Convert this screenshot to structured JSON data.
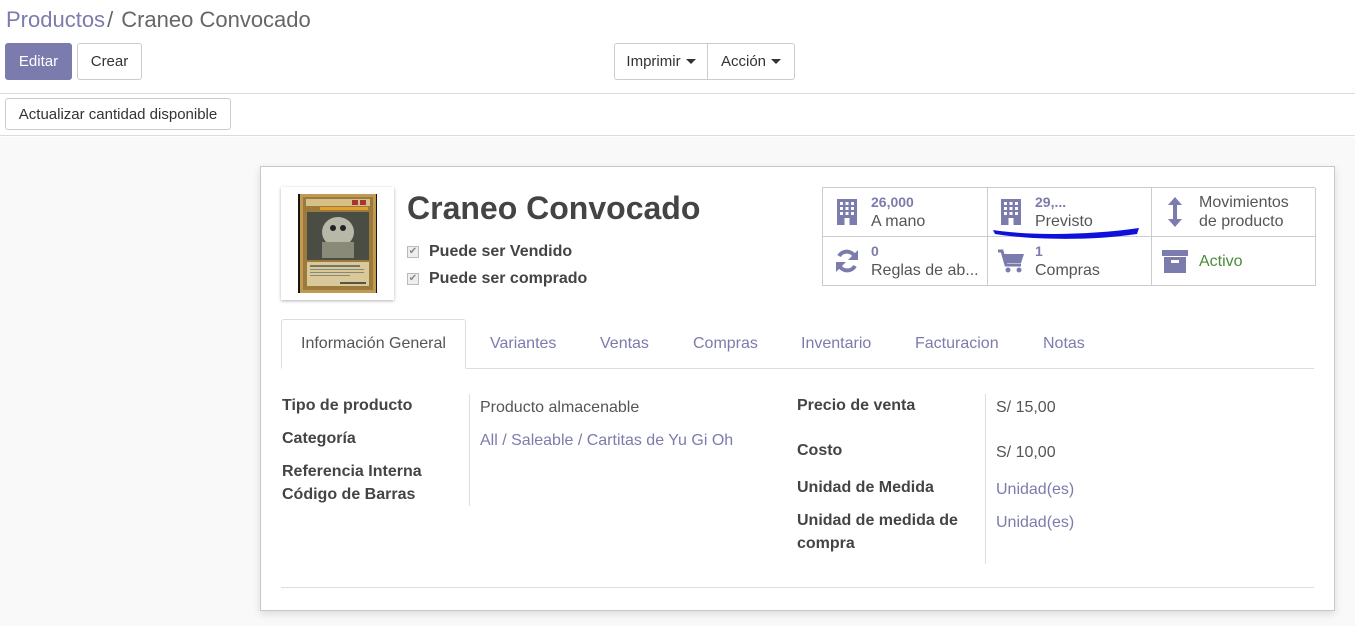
{
  "breadcrumb": {
    "parent": "Productos",
    "separator": "/",
    "current": "Craneo Convocado"
  },
  "toolbar": {
    "edit": "Editar",
    "create": "Crear",
    "print": "Imprimir",
    "action": "Acción",
    "update_qty": "Actualizar cantidad disponible"
  },
  "product": {
    "name": "Craneo Convocado",
    "can_be_sold": "Puede ser Vendido",
    "can_be_purchased": "Puede ser comprado"
  },
  "stats": [
    {
      "value": "26,000",
      "label": "A mano",
      "icon": "building-icon"
    },
    {
      "value": "29,...",
      "label": "Previsto",
      "icon": "building-icon"
    },
    {
      "value": "",
      "label": "Movimientos",
      "label2": "de producto",
      "icon": "up-down-arrow-icon"
    },
    {
      "value": "0",
      "label": "Reglas de ab...",
      "icon": "refresh-icon"
    },
    {
      "value": "1",
      "label": "Compras",
      "icon": "cart-icon"
    },
    {
      "value": "",
      "label": "Activo",
      "icon": "archive-icon"
    }
  ],
  "tabs": [
    "Información General",
    "Variantes",
    "Ventas",
    "Compras",
    "Inventario",
    "Facturacion",
    "Notas"
  ],
  "general": {
    "product_type_label": "Tipo de producto",
    "product_type": "Producto almacenable",
    "category_label": "Categoría",
    "category": "All / Saleable / Cartitas de Yu Gi Oh",
    "internal_ref_label": "Referencia Interna",
    "barcode_label": "Código de Barras",
    "sale_price_label": "Precio de venta",
    "sale_price": "S/ 15,00",
    "cost_label": "Costo",
    "cost": "S/ 10,00",
    "uom_label": "Unidad de Medida",
    "uom": "Unidad(es)",
    "purchase_uom_label_1": "Unidad de medida de",
    "purchase_uom_label_2": "compra",
    "purchase_uom": "Unidad(es)"
  },
  "colors": {
    "accent": "#7c7bad",
    "active_green": "#4a8a3a",
    "annotation": "#1010dd"
  }
}
